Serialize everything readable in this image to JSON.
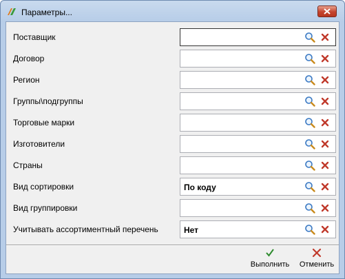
{
  "window": {
    "title": "Параметры...",
    "close_icon": "close-icon"
  },
  "fields": [
    {
      "label": "Поставщик",
      "value": ""
    },
    {
      "label": "Договор",
      "value": ""
    },
    {
      "label": "Регион",
      "value": ""
    },
    {
      "label": "Группы\\подгруппы",
      "value": ""
    },
    {
      "label": "Торговые марки",
      "value": ""
    },
    {
      "label": "Изготовители",
      "value": ""
    },
    {
      "label": "Страны",
      "value": ""
    },
    {
      "label": "Вид сортировки",
      "value": "По коду"
    },
    {
      "label": "Вид группировки",
      "value": ""
    },
    {
      "label": "Учитывать ассортиментный перечень",
      "value": "Нет"
    }
  ],
  "actions": {
    "execute_label": "Выполнить",
    "cancel_label": "Отменить"
  },
  "colors": {
    "clear_icon": "#c0392b",
    "execute_icon": "#2e8b2e",
    "cancel_icon": "#c0392b"
  }
}
